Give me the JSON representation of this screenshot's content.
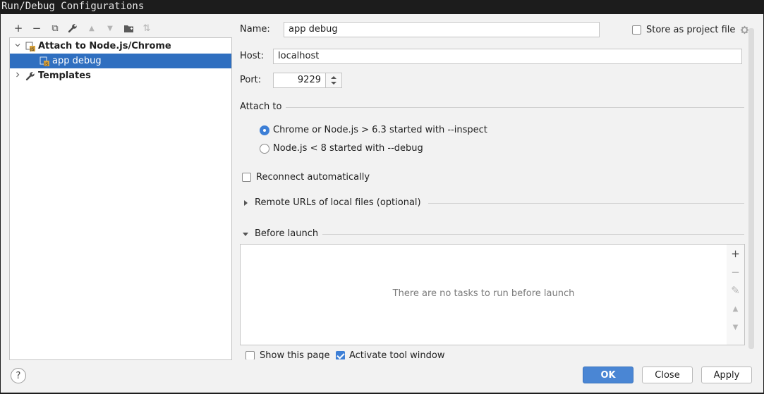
{
  "window": {
    "title": "Run/Debug Configurations"
  },
  "toolbar": {
    "add": "+",
    "remove": "−",
    "copy": "⧉",
    "edit": "🔧",
    "up": "▲",
    "down": "▼",
    "folder": "▣",
    "sort": "⇅"
  },
  "tree": {
    "items": [
      {
        "label": "Attach to Node.js/Chrome",
        "expanded": true,
        "bold": true
      },
      {
        "label": "app debug",
        "selected": true
      },
      {
        "label": "Templates",
        "expanded": false,
        "bold": true
      }
    ]
  },
  "form": {
    "name_label": "Name:",
    "name_value": "app debug",
    "store_label": "Store as project file",
    "host_label": "Host:",
    "host_value": "localhost",
    "port_label": "Port:",
    "port_value": "9229",
    "attach_to_label": "Attach to",
    "attach_options": [
      {
        "label": "Chrome or Node.js > 6.3 started with --inspect",
        "selected": true
      },
      {
        "label": "Node.js < 8 started with --debug",
        "selected": false
      }
    ],
    "reconnect_label": "Reconnect automatically",
    "remote_urls_label": "Remote URLs of local files (optional)",
    "before_launch_label": "Before launch",
    "no_tasks_text": "There are no tasks to run before launch",
    "show_page_label": "Show this page",
    "activate_tool_label": "Activate tool window"
  },
  "side_tools": {
    "add": "+",
    "remove": "−",
    "edit": "✎",
    "up": "▲",
    "down": "▼"
  },
  "buttons": {
    "help": "?",
    "ok": "OK",
    "close": "Close",
    "apply": "Apply"
  },
  "colors": {
    "accent": "#3d7fd6",
    "selection": "#2f6fc0"
  }
}
